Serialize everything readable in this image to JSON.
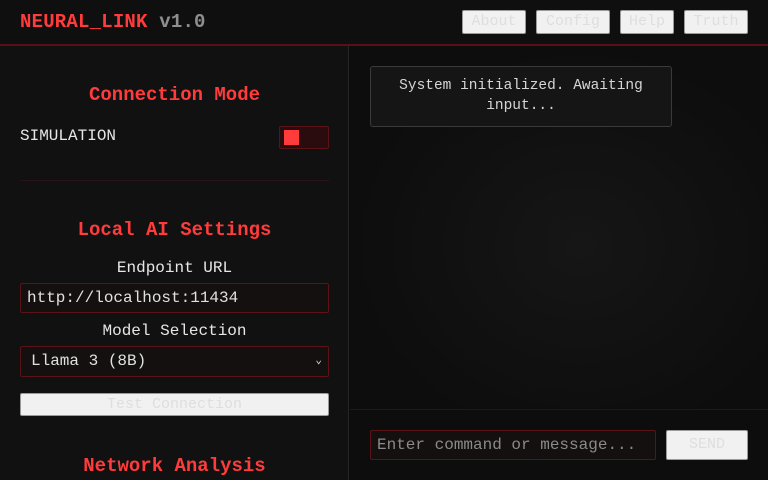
{
  "header": {
    "app_name": "NEURAL_LINK",
    "version": "v1.0",
    "nav": [
      "About",
      "Config",
      "Help",
      "Truth"
    ]
  },
  "sidebar": {
    "connection": {
      "title": "Connection Mode",
      "mode_label": "SIMULATION",
      "toggle_on": true
    },
    "local_ai": {
      "title": "Local AI Settings",
      "endpoint_label": "Endpoint URL",
      "endpoint_value": "http://localhost:11434",
      "model_label": "Model Selection",
      "model_selected": "Llama 3 (8B)",
      "test_button": "Test Connection"
    },
    "network": {
      "title": "Network Analysis"
    }
  },
  "chat": {
    "messages": [
      "System initialized. Awaiting input..."
    ]
  },
  "composer": {
    "placeholder": "Enter command or message...",
    "send_label": "SEND"
  },
  "colors": {
    "accent": "#ff3b3b",
    "border_accent": "#5a1418",
    "background": "#0b0b0b"
  }
}
